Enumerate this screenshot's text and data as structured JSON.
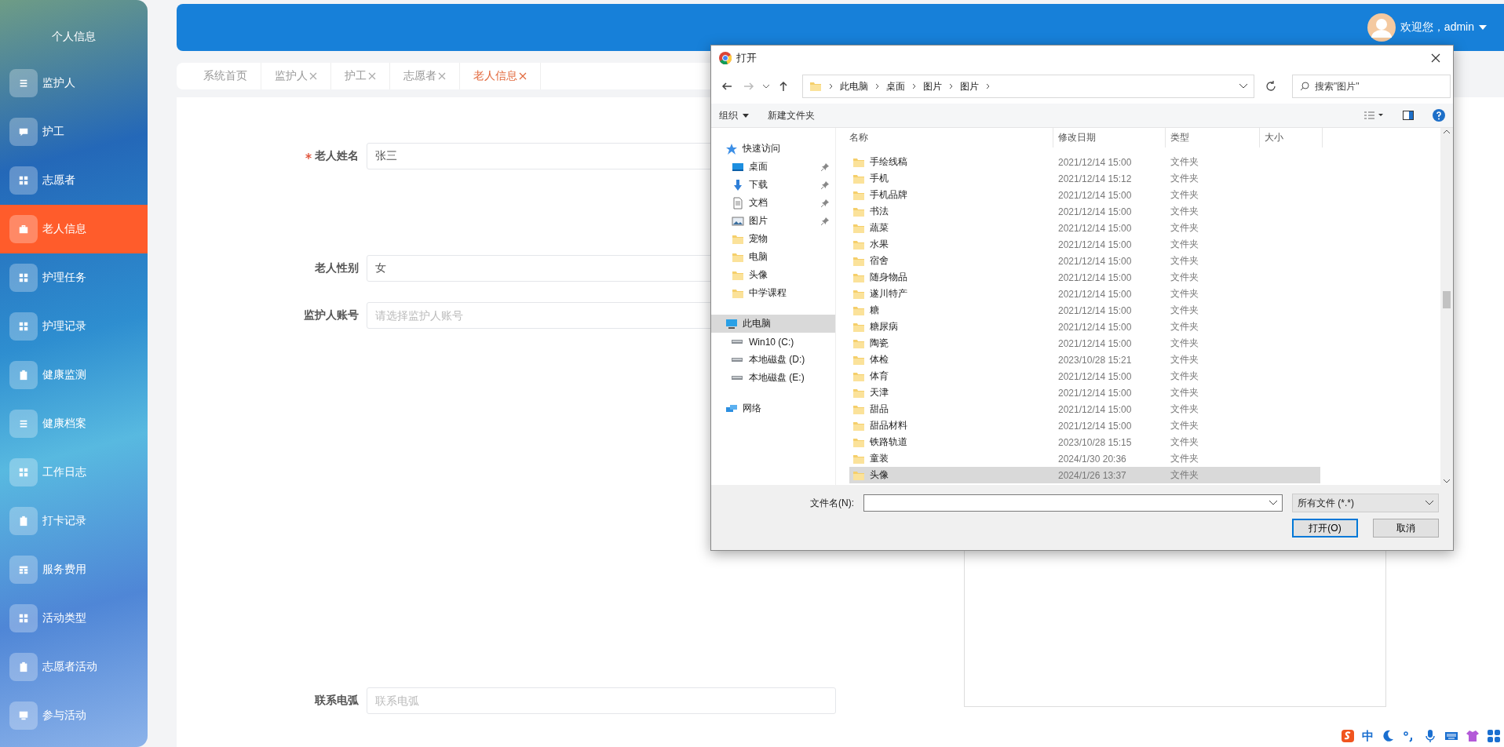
{
  "sidebar": {
    "title": "个人信息",
    "items": [
      {
        "label": "监护人",
        "selected": false
      },
      {
        "label": "护工",
        "selected": false
      },
      {
        "label": "志愿者",
        "selected": false
      },
      {
        "label": "老人信息",
        "selected": true
      },
      {
        "label": "护理任务",
        "selected": false
      },
      {
        "label": "护理记录",
        "selected": false
      },
      {
        "label": "健康监测",
        "selected": false
      },
      {
        "label": "健康档案",
        "selected": false
      },
      {
        "label": "工作日志",
        "selected": false
      },
      {
        "label": "打卡记录",
        "selected": false
      },
      {
        "label": "服务费用",
        "selected": false
      },
      {
        "label": "活动类型",
        "selected": false
      },
      {
        "label": "志愿者活动",
        "selected": false
      },
      {
        "label": "参与活动",
        "selected": false
      }
    ]
  },
  "header": {
    "welcome": "欢迎您，admin"
  },
  "tabs": [
    {
      "label": "系统首页",
      "closable": false,
      "selected": false
    },
    {
      "label": "监护人",
      "closable": true,
      "selected": false
    },
    {
      "label": "护工",
      "closable": true,
      "selected": false
    },
    {
      "label": "志愿者",
      "closable": true,
      "selected": false
    },
    {
      "label": "老人信息",
      "closable": true,
      "selected": true
    }
  ],
  "form": {
    "fields": [
      {
        "label": "老人姓名",
        "required": true,
        "value": "张三"
      },
      {
        "label": "老人性别",
        "required": false,
        "value": "女"
      },
      {
        "label": "监护人账号",
        "required": false,
        "placeholder": "请选择监护人账号"
      },
      {
        "label": "联系电弧",
        "required": false,
        "placeholder": "联系电弧"
      }
    ]
  },
  "dialog": {
    "title": "打开",
    "path": [
      "此电脑",
      "桌面",
      "图片",
      "图片"
    ],
    "search_placeholder": "搜索\"图片\"",
    "toolbar": {
      "organize": "组织",
      "new_folder": "新建文件夹"
    },
    "nav": [
      {
        "label": "快速访问",
        "kind": "star",
        "selected": false,
        "children": [
          {
            "label": "桌面",
            "kind": "desktop",
            "pinned": true,
            "selected": false
          },
          {
            "label": "下载",
            "kind": "download",
            "pinned": true,
            "selected": false
          },
          {
            "label": "文档",
            "kind": "document",
            "pinned": true,
            "selected": false
          },
          {
            "label": "图片",
            "kind": "pictures",
            "pinned": true,
            "selected": false
          },
          {
            "label": "宠物",
            "kind": "folder",
            "pinned": false,
            "selected": false
          },
          {
            "label": "电脑",
            "kind": "folder",
            "pinned": false,
            "selected": false
          },
          {
            "label": "头像",
            "kind": "folder",
            "pinned": false,
            "selected": false
          },
          {
            "label": "中学课程",
            "kind": "folder",
            "pinned": false,
            "selected": false
          }
        ]
      },
      {
        "label": "此电脑",
        "kind": "pc",
        "selected": true,
        "children": [
          {
            "label": "Win10 (C:)",
            "kind": "drive",
            "pinned": false,
            "selected": false
          },
          {
            "label": "本地磁盘 (D:)",
            "kind": "drive",
            "pinned": false,
            "selected": false
          },
          {
            "label": "本地磁盘 (E:)",
            "kind": "drive",
            "pinned": false,
            "selected": false
          }
        ]
      },
      {
        "label": "网络",
        "kind": "network",
        "selected": false
      }
    ],
    "columns": [
      "名称",
      "修改日期",
      "类型",
      "大小"
    ],
    "files": [
      {
        "name": "手绘线稿",
        "modified": "2021/12/14 15:00",
        "type": "文件夹",
        "selected": false
      },
      {
        "name": "手机",
        "modified": "2021/12/14 15:12",
        "type": "文件夹",
        "selected": false
      },
      {
        "name": "手机品牌",
        "modified": "2021/12/14 15:00",
        "type": "文件夹",
        "selected": false
      },
      {
        "name": "书法",
        "modified": "2021/12/14 15:00",
        "type": "文件夹",
        "selected": false
      },
      {
        "name": "蔬菜",
        "modified": "2021/12/14 15:00",
        "type": "文件夹",
        "selected": false
      },
      {
        "name": "水果",
        "modified": "2021/12/14 15:00",
        "type": "文件夹",
        "selected": false
      },
      {
        "name": "宿舍",
        "modified": "2021/12/14 15:00",
        "type": "文件夹",
        "selected": false
      },
      {
        "name": "随身物品",
        "modified": "2021/12/14 15:00",
        "type": "文件夹",
        "selected": false
      },
      {
        "name": "遂川特产",
        "modified": "2021/12/14 15:00",
        "type": "文件夹",
        "selected": false
      },
      {
        "name": "糖",
        "modified": "2021/12/14 15:00",
        "type": "文件夹",
        "selected": false
      },
      {
        "name": "糖尿病",
        "modified": "2021/12/14 15:00",
        "type": "文件夹",
        "selected": false
      },
      {
        "name": "陶瓷",
        "modified": "2021/12/14 15:00",
        "type": "文件夹",
        "selected": false
      },
      {
        "name": "体检",
        "modified": "2023/10/28 15:21",
        "type": "文件夹",
        "selected": false
      },
      {
        "name": "体育",
        "modified": "2021/12/14 15:00",
        "type": "文件夹",
        "selected": false
      },
      {
        "name": "天津",
        "modified": "2021/12/14 15:00",
        "type": "文件夹",
        "selected": false
      },
      {
        "name": "甜品",
        "modified": "2021/12/14 15:00",
        "type": "文件夹",
        "selected": false
      },
      {
        "name": "甜品材料",
        "modified": "2021/12/14 15:00",
        "type": "文件夹",
        "selected": false
      },
      {
        "name": "铁路轨道",
        "modified": "2023/10/28 15:15",
        "type": "文件夹",
        "selected": false
      },
      {
        "name": "童装",
        "modified": "2024/1/30 20:36",
        "type": "文件夹",
        "selected": false
      },
      {
        "name": "头像",
        "modified": "2024/1/26 13:37",
        "type": "文件夹",
        "selected": true
      }
    ],
    "filename_label": "文件名(N):",
    "filter": "所有文件 (*.*)",
    "buttons": [
      {
        "label": "打开(O)",
        "kind": "default"
      },
      {
        "label": "取消",
        "kind": "normal"
      }
    ]
  },
  "tray": {
    "ime": "中"
  }
}
